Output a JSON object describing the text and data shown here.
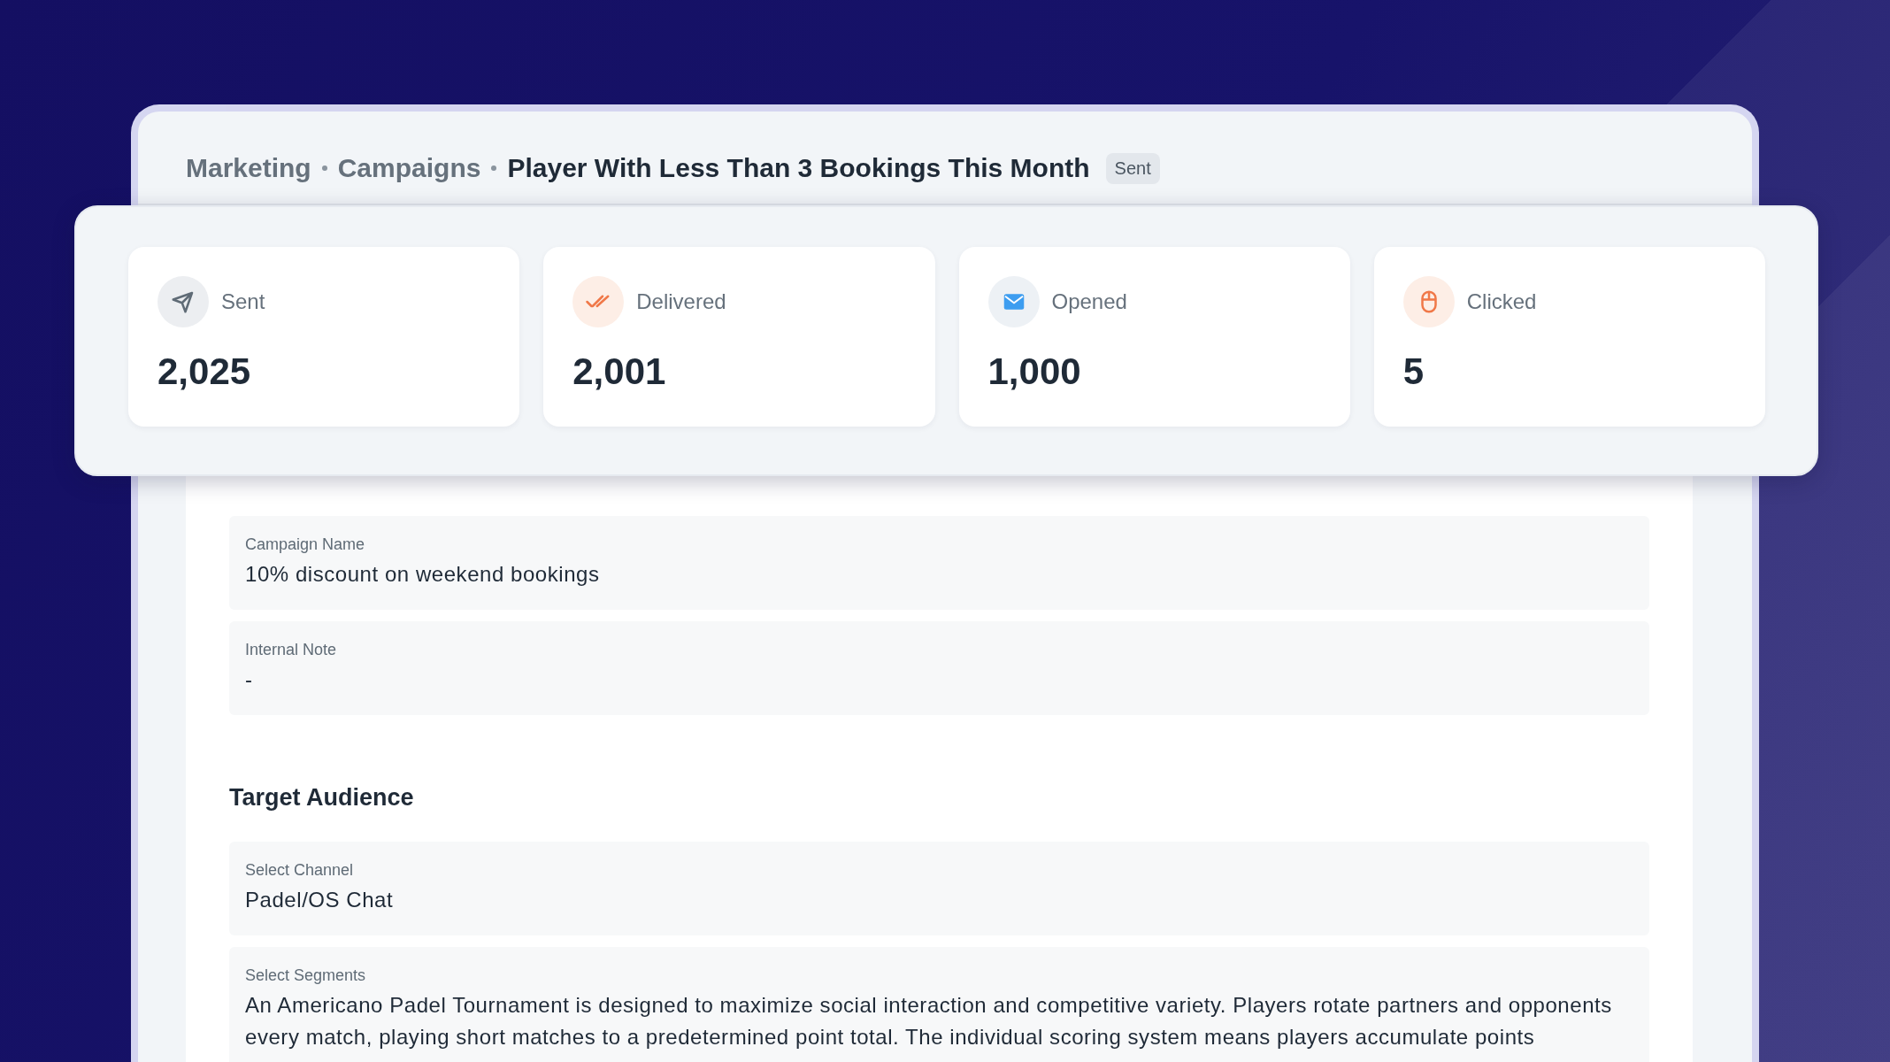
{
  "breadcrumb": [
    {
      "label": "Marketing",
      "current": false
    },
    {
      "label": "Campaigns",
      "current": false
    },
    {
      "label": "Player With Less Than 3 Bookings This Month",
      "current": true
    }
  ],
  "status_badge": "Sent",
  "stats": [
    {
      "kind": "sent",
      "label": "Sent",
      "value": "2,025"
    },
    {
      "kind": "delivered",
      "label": "Delivered",
      "value": "2,001"
    },
    {
      "kind": "opened",
      "label": "Opened",
      "value": "1,000"
    },
    {
      "kind": "clicked",
      "label": "Clicked",
      "value": "5"
    }
  ],
  "campaign_fields": [
    {
      "label": "Campaign Name",
      "value": "10% discount on weekend bookings"
    },
    {
      "label": "Internal Note",
      "value": "-"
    }
  ],
  "target_audience": {
    "title": "Target Audience",
    "fields": [
      {
        "label": "Select Channel",
        "value": "Padel/OS Chat"
      },
      {
        "label": "Select Segments",
        "value": "An Americano Padel Tournament is designed to maximize social interaction and competitive variety. Players rotate partners and opponents every match, playing short matches to a predetermined point total. The individual scoring system means players accumulate points"
      }
    ]
  }
}
